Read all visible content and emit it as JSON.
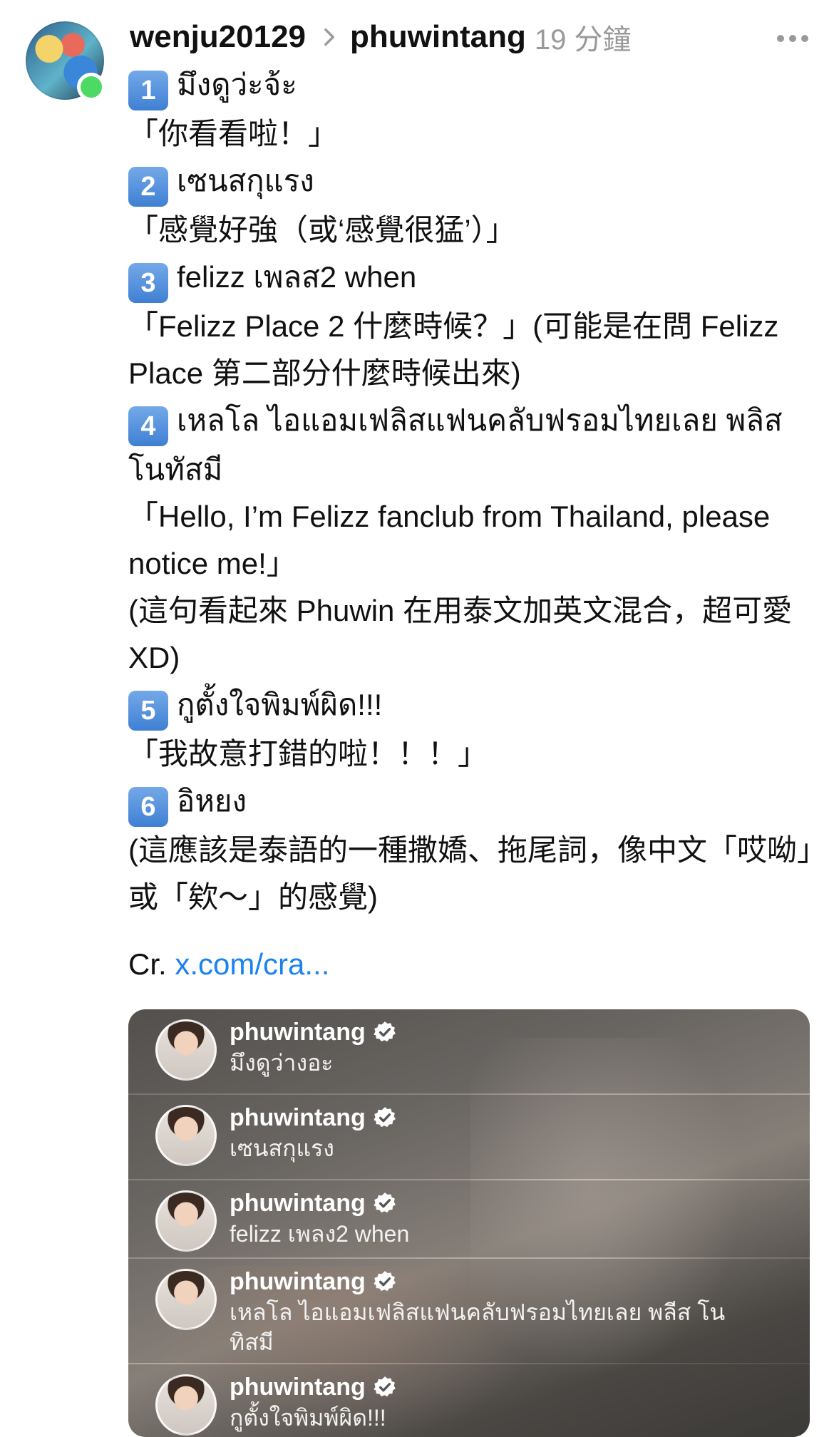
{
  "post": {
    "author": "wenju20129",
    "reply_to": "phuwintang",
    "time": "19 分鐘",
    "items": [
      {
        "num": "1",
        "thai": "มึงดูว่ะจ้ะ",
        "trans": "「你看看啦！」"
      },
      {
        "num": "2",
        "thai": "เซนสกุแรง",
        "trans": "「感覺好強（或‘感覺很猛’）」"
      },
      {
        "num": "3",
        "thai": "felizz เพลส2 when",
        "trans": "「Felizz Place 2 什麼時候？」(可能是在問 Felizz Place 第二部分什麼時候出來)"
      },
      {
        "num": "4",
        "thai": "เหลโล ไอแอมเฟลิสแฟนคลับฟรอมไทยเลย พลิส โนทัสมี",
        "trans": "「Hello, I’m Felizz fanclub from Thailand, please notice me!」",
        "note": "(這句看起來 Phuwin 在用泰文加英文混合，超可愛XD)"
      },
      {
        "num": "5",
        "thai": "กูตั้งใจพิมพ์ผิด!!!",
        "trans": "「我故意打錯的啦！！！」"
      },
      {
        "num": "6",
        "thai": "อิหยง",
        "trans": "(這應該是泰語的一種撒嬌、拖尾詞，像中文「哎呦」或「欸～」的感覺)"
      }
    ],
    "credit_prefix": "Cr.",
    "credit_link": "x.com/cra..."
  },
  "media": {
    "comments": [
      {
        "name": "phuwintang",
        "msg": "มึงดูว่างอะ"
      },
      {
        "name": "phuwintang",
        "msg": "เซนสกุแรง"
      },
      {
        "name": "phuwintang",
        "msg": "felizz เพลง2 when"
      },
      {
        "name": "phuwintang",
        "msg": "เหลโล ไอแอมเฟลิสแฟนคลับฟรอมไทยเลย พลีส โนทิสมี"
      },
      {
        "name": "phuwintang",
        "msg": "กูตั้งใจพิมพ์ผิด!!!"
      }
    ]
  },
  "colors": {
    "link": "#1a83f0",
    "online": "#4cd964",
    "keycap": "#3f7fd3",
    "muted": "#999999"
  }
}
